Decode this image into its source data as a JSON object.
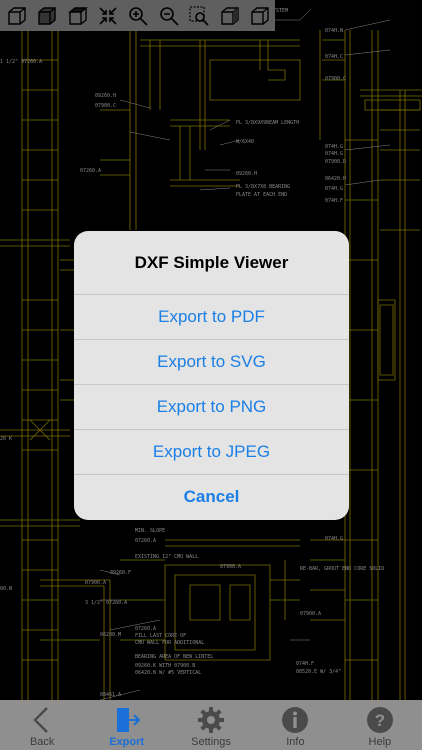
{
  "toolbar": {
    "icons": [
      "box-wire-icon",
      "box-solid-icon",
      "box-top-icon",
      "fit-screen-icon",
      "zoom-in-icon",
      "zoom-out-icon",
      "zoom-window-icon",
      "box-side-icon",
      "box-iso-icon"
    ]
  },
  "drawing": {
    "labels": [
      "SYSTEM",
      "09260.H",
      "07900.C",
      "PL 3/8X9X9BEAM LENGTH",
      "W/6X40",
      "09260.H",
      "07260.A",
      "PL 3/8X7X8 BEARING",
      "PLATE AT EACH END",
      "074H.N",
      "074H.C",
      "07900.C",
      "074H.G",
      "074H.G",
      "07900.D",
      "06420.H",
      "074H.G",
      "074H.F",
      "074H.G",
      "074H.C",
      "074H.G",
      "074H.F",
      "074H.H",
      "074H.G",
      "074H.F",
      "08520.E W/ 3/4\"",
      "MIN. SLOPE",
      "07260.A",
      "EXISTING 12\" CMU WALL",
      "09260.F",
      "07900.A",
      "07900.A",
      "3 1/2\" 07260.A",
      "06200.M",
      "07260.A",
      "FILL LAST CORE OF",
      "CMU WALL FOR ADDITIONAL",
      "BEARING AREA OF NEW LINTEL",
      "09260.K WITH 07900.B",
      "06420.B W/ #5 VERTICAL",
      "RE-BAR, GROUT END CORE SOLID",
      "07900.A",
      "08461.A",
      "1 1/2\" 07260.A",
      "20 K",
      "00.N",
      "00.B"
    ],
    "colors": {
      "background": "#000000",
      "lines": "#c8b400",
      "text": "#d8d8d8"
    }
  },
  "dialog": {
    "title": "DXF Simple Viewer",
    "actions": [
      "Export to PDF",
      "Export to SVG",
      "Export to PNG",
      "Export to JPEG"
    ],
    "cancel": "Cancel",
    "accent_color": "#1a7fe6"
  },
  "tabbar": {
    "tabs": [
      {
        "label": "Back",
        "icon": "chevron-left-icon",
        "active": false
      },
      {
        "label": "Export",
        "icon": "export-icon",
        "active": true
      },
      {
        "label": "Settings",
        "icon": "gear-icon",
        "active": false
      },
      {
        "label": "Info",
        "icon": "info-icon",
        "active": false
      },
      {
        "label": "Help",
        "icon": "help-icon",
        "active": false
      }
    ],
    "active_color": "#1a6fd8"
  }
}
